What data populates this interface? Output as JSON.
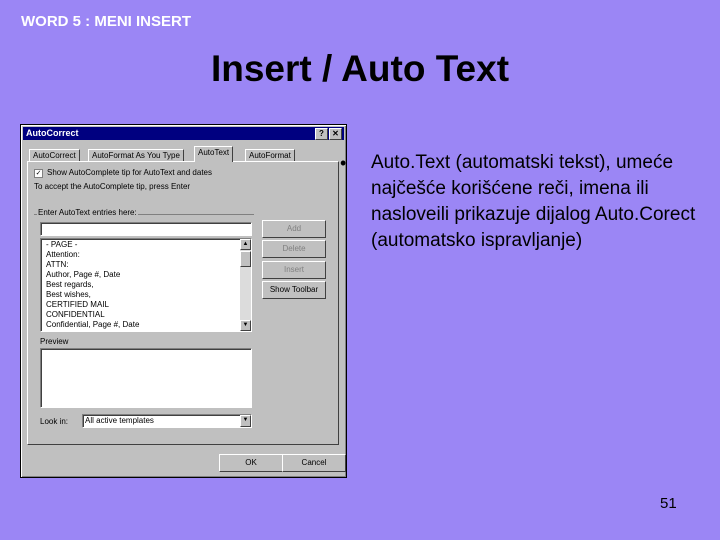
{
  "header": {
    "label": "WORD 5 : MENI INSERT"
  },
  "slide": {
    "title": "Insert / Auto Text",
    "bullet_text": "Auto.Text (automatski tekst), umeće najčešće korišćene reči, imena ili nasloveili prikazuje dijalog Auto.Corect (automatsko ispravljanje)",
    "bullet_mark": "•",
    "page_number": "51"
  },
  "dialog": {
    "title": "AutoCorrect",
    "help_glyph": "?",
    "close_glyph": "✕",
    "tabs": [
      "AutoCorrect",
      "AutoFormat As You Type",
      "AutoText",
      "AutoFormat"
    ],
    "active_tab": "AutoText",
    "show_autocomplete_label": "Show AutoComplete tip for AutoText and dates",
    "show_autocomplete_checked": true,
    "accept_hint": "To accept the AutoComplete tip, press Enter",
    "entries_label": "Enter AutoText entries here:",
    "entry_input_value": "",
    "entries": [
      "- PAGE -",
      "Attention:",
      "ATTN:",
      "Author, Page #, Date",
      "Best regards,",
      "Best wishes,",
      "CERTIFIED MAIL",
      "CONFIDENTIAL",
      "Confidential, Page #, Date"
    ],
    "buttons": {
      "add": "Add",
      "delete": "Delete",
      "insert": "Insert",
      "show_toolbar": "Show Toolbar",
      "ok": "OK",
      "cancel": "Cancel"
    },
    "preview_label": "Preview",
    "look_in_label": "Look in:",
    "look_in_value": "All active templates"
  }
}
